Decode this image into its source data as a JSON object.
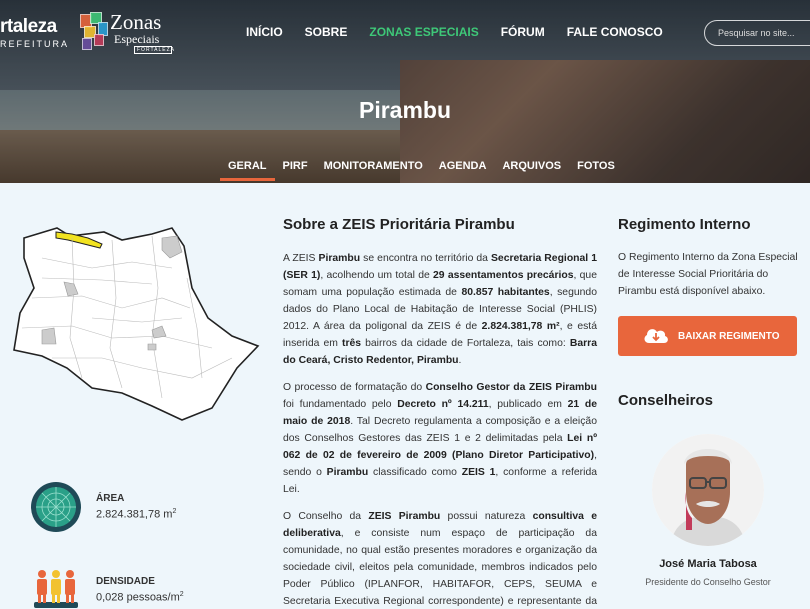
{
  "brand": {
    "city_name": "rtaleza",
    "city_sub": "REFEITURA",
    "zonas_title": "Zonas",
    "zonas_sub": "Especiais",
    "zonas_tag": "FORTALEZA",
    "square_colors": [
      "#e8663c",
      "#3ec878",
      "#2a9fd6",
      "#f2c230",
      "#c23b5a",
      "#6a4ea0"
    ]
  },
  "nav": {
    "items": [
      "INÍCIO",
      "SOBRE",
      "ZONAS ESPECIAIS",
      "FÓRUM",
      "FALE CONOSCO"
    ],
    "active_index": 2,
    "active_color": "#3ec878"
  },
  "search": {
    "placeholder": "Pesquisar no site..."
  },
  "page": {
    "title": "Pirambu"
  },
  "tabs": {
    "items": [
      "GERAL",
      "PIRF",
      "MONITORAMENTO",
      "AGENDA",
      "ARQUIVOS",
      "FOTOS"
    ],
    "active_index": 0,
    "accent": "#e8663c"
  },
  "stats": [
    {
      "label": "ÁREA",
      "value": "2.824.381,78 m",
      "sup": "2",
      "icon": "radar-icon"
    },
    {
      "label": "DENSIDADE",
      "value": "0,028 pessoas/m",
      "sup": "2",
      "icon": "people-icon"
    }
  ],
  "about": {
    "title": "Sobre a ZEIS Prioritária Pirambu",
    "p1": [
      "A ZEIS ",
      {
        "b": "Pirambu"
      },
      " se encontra no território da ",
      {
        "b": "Secretaria Regional 1 (SER 1)"
      },
      ", acolhendo um total de ",
      {
        "b": "29 assentamentos precários"
      },
      ", que somam uma população estimada de ",
      {
        "b": "80.857 habitantes"
      },
      ", segundo dados do Plano Local de Habitação de Interesse Social (PHLIS) 2012. A área da poligonal da ZEIS é de ",
      {
        "b": "2.824.381,78 m²"
      },
      ", e está inserida em ",
      {
        "b": "três"
      },
      " bairros da cidade de Fortaleza, tais como: ",
      {
        "b": "Barra do Ceará, Cristo Redentor, Pirambu"
      },
      "."
    ],
    "p2": [
      "O processo de formatação do ",
      {
        "b": "Conselho Gestor da ZEIS Pirambu"
      },
      " foi fundamentado pelo ",
      {
        "b": "Decreto nº 14.211"
      },
      ", publicado em ",
      {
        "b": "21 de maio de 2018"
      },
      ". Tal Decreto regulamenta a composição e a eleição dos Conselhos Gestores das ZEIS 1 e 2 delimitadas pela ",
      {
        "b": "Lei nº 062 de 02 de fevereiro de 2009 (Plano Diretor Participativo)"
      },
      ", sendo o ",
      {
        "b": "Pirambu"
      },
      " classificado como ",
      {
        "b": "ZEIS 1"
      },
      ", conforme a referida Lei."
    ],
    "p3": [
      "O Conselho da ",
      {
        "b": "ZEIS Pirambu"
      },
      " possui natureza ",
      {
        "b": "consultiva e deliberativa"
      },
      ", e consiste num espaço de participação da comunidade, no qual estão presentes moradores e organização da sociedade civil, eleitos pela comunidade, membros indicados pelo Poder Público (IPLANFOR, HABITAFOR, CEPS, SEUMA e Secretaria Executiva Regional correspondente) e representante da Câmara de Vereadores de Fortaleza."
    ]
  },
  "regimento": {
    "title": "Regimento Interno",
    "text": "O Regimento Interno da Zona Especial de Interesse Social Prioritária do Pirambu está disponível abaixo.",
    "button": "BAIXAR REGIMENTO",
    "button_color": "#e8663c"
  },
  "conselheiros": {
    "title": "Conselheiros",
    "members": [
      {
        "name": "José Maria Tabosa",
        "role": "Presidente do Conselho Gestor"
      }
    ]
  }
}
